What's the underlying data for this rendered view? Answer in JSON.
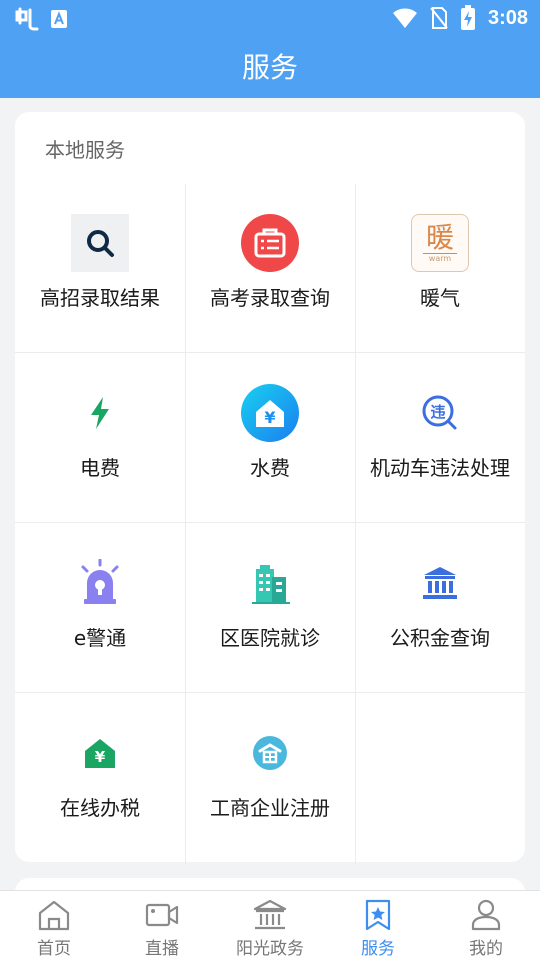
{
  "status_bar": {
    "time": "3:08"
  },
  "header": {
    "title": "服务"
  },
  "section": {
    "title": "本地服务",
    "items": [
      {
        "label": "高招录取结果",
        "icon": "search-icon"
      },
      {
        "label": "高考录取查询",
        "icon": "briefcase-icon"
      },
      {
        "label": "暖气",
        "icon": "heating-icon",
        "icon_text": "暖",
        "icon_subtext": "warm"
      },
      {
        "label": "电费",
        "icon": "lightning-icon"
      },
      {
        "label": "水费",
        "icon": "water-fee-icon",
        "icon_text": "¥"
      },
      {
        "label": "机动车违法处理",
        "icon": "violation-icon",
        "icon_text": "违"
      },
      {
        "label": "e警通",
        "icon": "police-light-icon"
      },
      {
        "label": "区医院就诊",
        "icon": "hospital-icon"
      },
      {
        "label": "公积金查询",
        "icon": "bank-icon"
      },
      {
        "label": "在线办税",
        "icon": "tax-icon",
        "icon_text": "¥"
      },
      {
        "label": "工商企业注册",
        "icon": "business-icon"
      }
    ]
  },
  "bottom_nav": {
    "items": [
      {
        "label": "首页",
        "icon": "home-icon"
      },
      {
        "label": "直播",
        "icon": "video-icon"
      },
      {
        "label": "阳光政务",
        "icon": "government-icon"
      },
      {
        "label": "服务",
        "icon": "bookmark-star-icon"
      },
      {
        "label": "我的",
        "icon": "user-icon"
      }
    ],
    "active": "服务"
  },
  "colors": {
    "primary": "#4ea1f3",
    "active_tab": "#3d8ef0",
    "red_icon": "#f04848",
    "green_icon": "#1aa562",
    "teal_icon": "#35c7b2",
    "blue_icon": "#3b6fe0",
    "purple_icon": "#8a80f0"
  }
}
